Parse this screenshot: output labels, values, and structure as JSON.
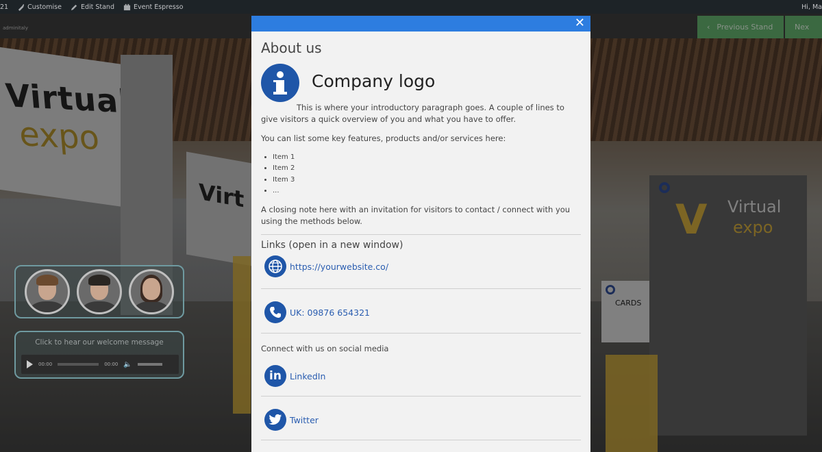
{
  "adminbar": {
    "left_fragment": "21",
    "items": [
      {
        "label": "Customise",
        "icon": "brush-icon"
      },
      {
        "label": "Edit Stand",
        "icon": "pencil-icon"
      },
      {
        "label": "Event Espresso",
        "icon": "calendar-icon"
      }
    ],
    "greeting": "Hi, Ma"
  },
  "scene": {
    "site_logo": "adminitaly",
    "banner_title": "Virtual",
    "banner_sub": "expo",
    "mid_banner": "Virt",
    "right_stand_title": "Virtual",
    "right_stand_sub": "expo",
    "cards_label": "CARDS"
  },
  "nav": {
    "prev_label": "Previous Stand",
    "next_label": "Nex"
  },
  "audio": {
    "message": "Click to hear our welcome message",
    "current_time": "00:00",
    "duration": "00:00"
  },
  "modal": {
    "title": "About us",
    "company_logo": "Company logo",
    "intro": "This is where your introductory paragraph goes. A couple of lines to give visitors a quick overview of you and what you have to offer.",
    "features_intro": "You can list some key features, products and/or services here:",
    "items": [
      "Item 1",
      "Item 2",
      "Item 3",
      "..."
    ],
    "closing": "A closing note here with an invitation for visitors to contact / connect with you using the methods below.",
    "links_title": "Links (open in a new window)",
    "website": "https://yourwebsite.co/",
    "phone": "UK: 09876 654321",
    "social_title": "Connect with us on social media",
    "linkedin": "LinkedIn",
    "twitter": "Twitter",
    "close_symbol": "✕",
    "accent": "#2d7de0",
    "icon_color": "#1f56a8"
  }
}
